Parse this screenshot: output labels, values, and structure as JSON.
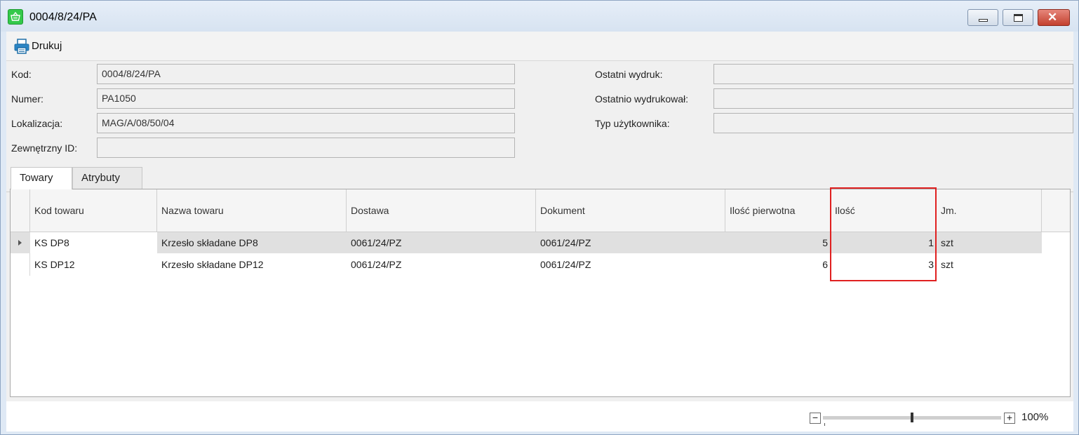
{
  "window": {
    "title": "0004/8/24/PA",
    "controls": {
      "minimize": "minimize",
      "maximize": "maximize",
      "close": "✕"
    }
  },
  "toolbar": {
    "print_label": "Drukuj"
  },
  "form": {
    "kod": {
      "label": "Kod:",
      "value": "0004/8/24/PA"
    },
    "numer": {
      "label": "Numer:",
      "value": "PA1050"
    },
    "lokalizacja": {
      "label": "Lokalizacja:",
      "value": "MAG/A/08/50/04"
    },
    "zewnetrzny_id": {
      "label": "Zewnętrzny ID:",
      "value": ""
    },
    "ostatni_wydruk": {
      "label": "Ostatni wydruk:",
      "value": ""
    },
    "ostatnio_wydrukowal": {
      "label": "Ostatnio wydrukował:",
      "value": ""
    },
    "typ_uzytkownika": {
      "label": "Typ użytkownika:",
      "value": ""
    }
  },
  "tabs": [
    {
      "label": "Towary",
      "active": true
    },
    {
      "label": "Atrybuty",
      "active": false
    }
  ],
  "grid": {
    "columns": [
      "Kod towaru",
      "Nazwa towaru",
      "Dostawa",
      "Dokument",
      "Ilość pierwotna",
      "Ilość",
      "Jm."
    ],
    "rows": [
      [
        "KS DP8",
        "Krzesło składane DP8",
        "0061/24/PZ",
        "0061/24/PZ",
        "5",
        "1",
        "szt"
      ],
      [
        "KS DP12",
        "Krzesło składane DP12",
        "0061/24/PZ",
        "0061/24/PZ",
        "6",
        "3",
        "szt"
      ]
    ],
    "selected_row": 0
  },
  "statusbar": {
    "zoom_minus": "−",
    "zoom_plus": "+",
    "zoom_value": "100%",
    "zoom_level": 100
  },
  "colors": {
    "highlight": "#e02020",
    "app_icon": "#34c94a",
    "close_button": "#c3402e"
  },
  "icons": {
    "app": "shopping-basket-icon",
    "print": "printer-icon"
  }
}
